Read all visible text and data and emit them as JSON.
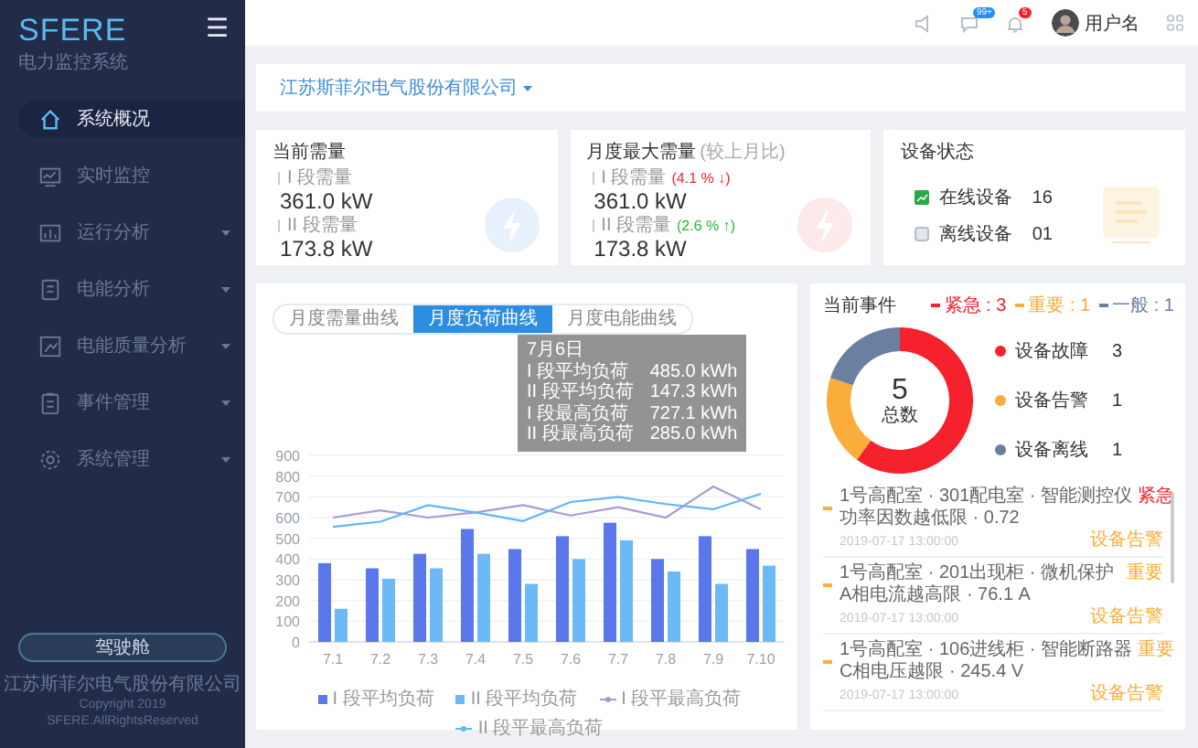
{
  "sidebar": {
    "logo": "SFERE",
    "subtitle": "电力监控系统",
    "menu_icon": "☰",
    "items": [
      {
        "label": "系统概况",
        "selected": true,
        "expandable": false
      },
      {
        "label": "实时监控",
        "selected": false,
        "expandable": false
      },
      {
        "label": "运行分析",
        "selected": false,
        "expandable": true
      },
      {
        "label": "电能分析",
        "selected": false,
        "expandable": true
      },
      {
        "label": "电能质量分析",
        "selected": false,
        "expandable": true
      },
      {
        "label": "事件管理",
        "selected": false,
        "expandable": true
      },
      {
        "label": "系统管理",
        "selected": false,
        "expandable": true
      }
    ],
    "cockpit_button": "驾驶舱",
    "company": "江苏斯菲尔电气股份有限公司",
    "copyright": "Copyright 2019",
    "rights": "SFERE.AllRightsReserved"
  },
  "header": {
    "message_badge": "99+",
    "alert_badge": "5",
    "user_name": "用户名"
  },
  "company_selector": {
    "value": "江苏斯菲尔电气股份有限公司"
  },
  "cards": [
    {
      "kind": "demand",
      "title": "当前需量",
      "rows": [
        {
          "label": "I 段需量",
          "value": "361.0 kW"
        },
        {
          "label": "II 段需量",
          "value": "173.8 kW"
        }
      ]
    },
    {
      "kind": "max_demand",
      "title": "月度最大需量",
      "note": "(较上月比)",
      "rows": [
        {
          "label": "I 段需量",
          "value": "361.0 kW",
          "change": "(4.1 % ↓)",
          "rising": false
        },
        {
          "label": "II 段需量",
          "value": "173.8 kW",
          "change": "(2.6 % ↑)",
          "rising": true
        }
      ]
    },
    {
      "kind": "devices",
      "title": "设备状态",
      "rows": [
        {
          "label": "在线设备",
          "value": "16",
          "online": true
        },
        {
          "label": "离线设备",
          "value": "01",
          "online": false
        }
      ]
    }
  ],
  "load_panel": {
    "tabs": [
      {
        "label": "月度需量曲线",
        "selected": false
      },
      {
        "label": "月度负荷曲线",
        "selected": true
      },
      {
        "label": "月度电能曲线",
        "selected": false
      }
    ],
    "chart_data": {
      "type": "bar",
      "stacked": false,
      "grid": true,
      "legend": "bottom",
      "categories": [
        "7.1",
        "7.2",
        "7.3",
        "7.4",
        "7.5",
        "7.6",
        "7.7",
        "7.8",
        "7.9",
        "7.10"
      ],
      "ylim": [
        0,
        900
      ],
      "yticks": [
        0,
        100,
        200,
        300,
        400,
        500,
        600,
        700,
        800,
        900
      ],
      "series": [
        {
          "name": "I 段平均负荷",
          "type": "bar",
          "color": "#5a77ec",
          "values": [
            380,
            355,
            425,
            545,
            448,
            510,
            575,
            400,
            510,
            448
          ]
        },
        {
          "name": "II 段平均负荷",
          "type": "bar",
          "color": "#6cb9f6",
          "values": [
            160,
            305,
            355,
            425,
            280,
            400,
            490,
            340,
            280,
            368
          ]
        },
        {
          "name": "I 段平最高负荷",
          "type": "line",
          "color": "#a99ad6",
          "values": [
            600,
            635,
            600,
            625,
            660,
            610,
            650,
            600,
            750,
            640
          ]
        },
        {
          "name": "II 段平最高负荷",
          "type": "line",
          "color": "#5fb6fa",
          "values": [
            555,
            580,
            660,
            625,
            583,
            675,
            700,
            665,
            640,
            715
          ]
        }
      ]
    },
    "tooltip": {
      "title": "7月6日",
      "rows": [
        {
          "label": "I 段平均负荷",
          "value": "485.0 kWh"
        },
        {
          "label": "II 段平均负荷",
          "value": "147.3 kWh"
        },
        {
          "label": "I 段最高负荷",
          "value": "727.1 kWh"
        },
        {
          "label": "II 段最高负荷",
          "value": "285.0 kWh"
        }
      ]
    }
  },
  "events_panel": {
    "title": "当前事件",
    "levels": [
      {
        "label": "紧急 : 3",
        "color": "#f5222d"
      },
      {
        "label": "重要 : 1",
        "color": "#faad3b"
      },
      {
        "label": "一般 : 1",
        "color": "#6b7fa0"
      }
    ],
    "chart_data": {
      "type": "donut",
      "legend": "right",
      "categories": [
        "设备故障",
        "设备告警",
        "设备离线"
      ],
      "values": [
        3,
        1,
        1
      ],
      "value_labels": [
        "3",
        "1",
        "1"
      ],
      "colors": [
        "#f5222d",
        "#faad3b",
        "#6b7fa0"
      ]
    },
    "center_value": "5",
    "center_label": "总数",
    "events": [
      {
        "line1": "1号高配室 · 301配电室 · 智能测控仪",
        "line2": "功率因数越低限 · 0.72",
        "level": "紧急",
        "urgent": true,
        "time": "2019-07-17  13:00:00",
        "type": "设备告警"
      },
      {
        "line1": "1号高配室 · 201出现柜 · 微机保护",
        "line2": "A相电流越高限 · 76.1 A",
        "level": "重要",
        "urgent": false,
        "time": "2019-07-17  13:00:00",
        "type": "设备告警"
      },
      {
        "line1": "1号高配室 · 106进线柜 · 智能断路器",
        "line2": "C相电压越限 · 245.4 V",
        "level": "重要",
        "urgent": false,
        "time": "2019-07-17  13:00:00",
        "type": "设备告警"
      }
    ]
  }
}
